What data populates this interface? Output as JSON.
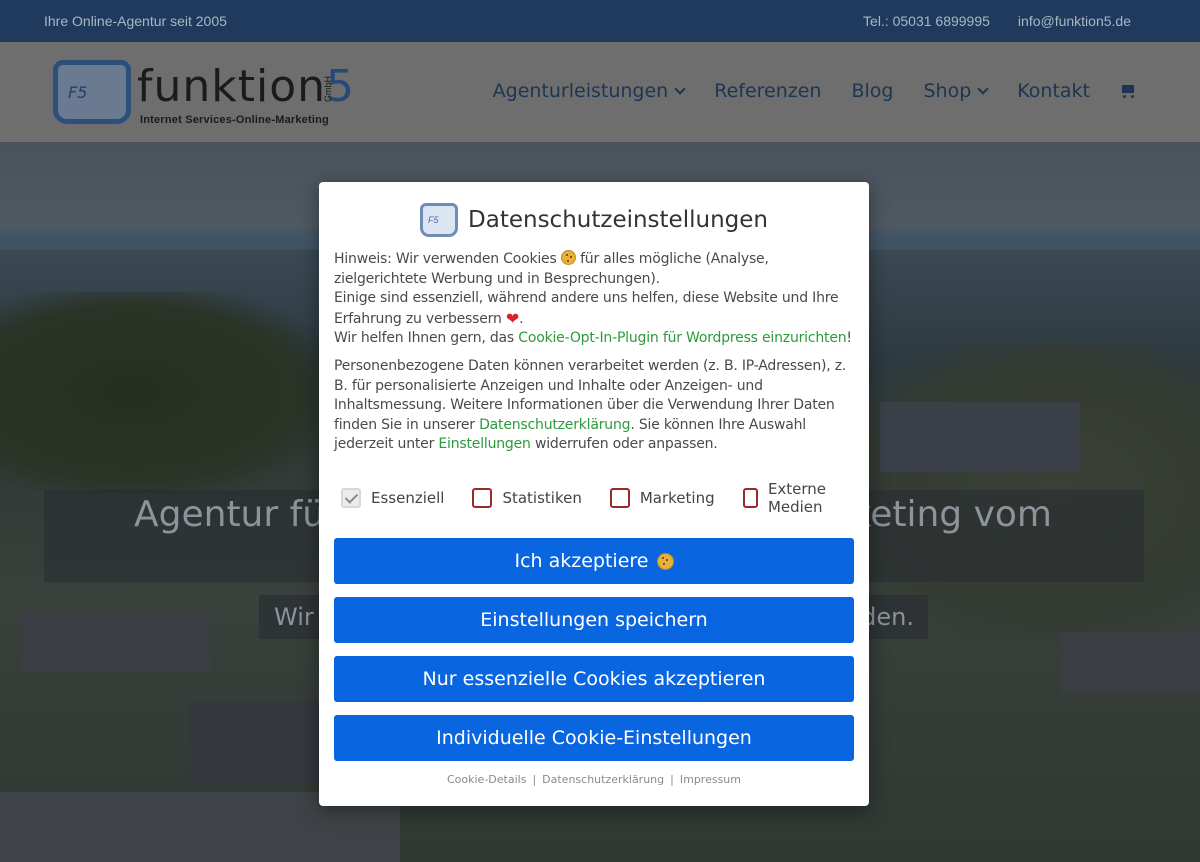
{
  "topbar": {
    "tagline": "Ihre Online-Agentur seit 2005",
    "phone": "Tel.: 05031 6899995",
    "email": "info@funktion5.de"
  },
  "logo": {
    "key_text": "F5",
    "word": "funktion",
    "number": "5",
    "suffix": "GmbH",
    "subtitle": "Internet Services-Online-Marketing"
  },
  "nav": {
    "items": [
      {
        "label": "Agenturleistungen",
        "has_dropdown": true
      },
      {
        "label": "Referenzen",
        "has_dropdown": false
      },
      {
        "label": "Blog",
        "has_dropdown": false
      },
      {
        "label": "Shop",
        "has_dropdown": true
      },
      {
        "label": "Kontakt",
        "has_dropdown": false
      }
    ],
    "cart_icon": "shopping-cart-icon"
  },
  "hero": {
    "title_left": "Agentur für",
    "title_right": "rketing vom",
    "sub_left": "Wir",
    "sub_right": "den."
  },
  "modal": {
    "logo_text": "F5",
    "title": "Datenschutzeinstellungen",
    "p1_a": "Hinweis: Wir verwenden Cookies ",
    "p1_b": " für alles mögliche (Analyse, zielgerichtete Werbung und in Besprechungen).",
    "p1_c": "Einige sind essenziell, während andere uns helfen, diese Website und Ihre Erfahrung zu verbessern ",
    "p1_d": ".",
    "p1_e": "Wir helfen Ihnen gern, das ",
    "p1_link": "Cookie-Opt-In-Plugin für Wordpress einzurichten",
    "p1_f": "!",
    "p2_a": "Personenbezogene Daten können verarbeitet werden (z. B. IP-Adressen), z. B. für personalisierte Anzeigen und Inhalte oder Anzeigen- und Inhaltsmessung. Weitere Informationen über die Verwendung Ihrer Daten finden Sie in unserer ",
    "p2_link1": "Datenschutzerklärung",
    "p2_b": ". Sie können Ihre Auswahl jederzeit unter ",
    "p2_link2": "Einstellungen",
    "p2_c": " widerrufen oder anpassen.",
    "checkboxes": [
      {
        "label": "Essenziell",
        "checked": true,
        "disabled": true
      },
      {
        "label": "Statistiken",
        "checked": false,
        "disabled": false
      },
      {
        "label": "Marketing",
        "checked": false,
        "disabled": false
      },
      {
        "label": "Externe Medien",
        "checked": false,
        "disabled": false
      }
    ],
    "buttons": {
      "accept": "Ich akzeptiere",
      "save": "Einstellungen speichern",
      "essential": "Nur essenzielle Cookies akzeptieren",
      "individual": "Individuelle Cookie-Einstellungen"
    },
    "footer": {
      "details": "Cookie-Details",
      "privacy": "Datenschutzerklärung",
      "imprint": "Impressum",
      "separator": "|"
    },
    "colors": {
      "button": "#0a66e0",
      "link": "#2b9b3c",
      "checkbox_border": "#9a2a2a"
    }
  }
}
